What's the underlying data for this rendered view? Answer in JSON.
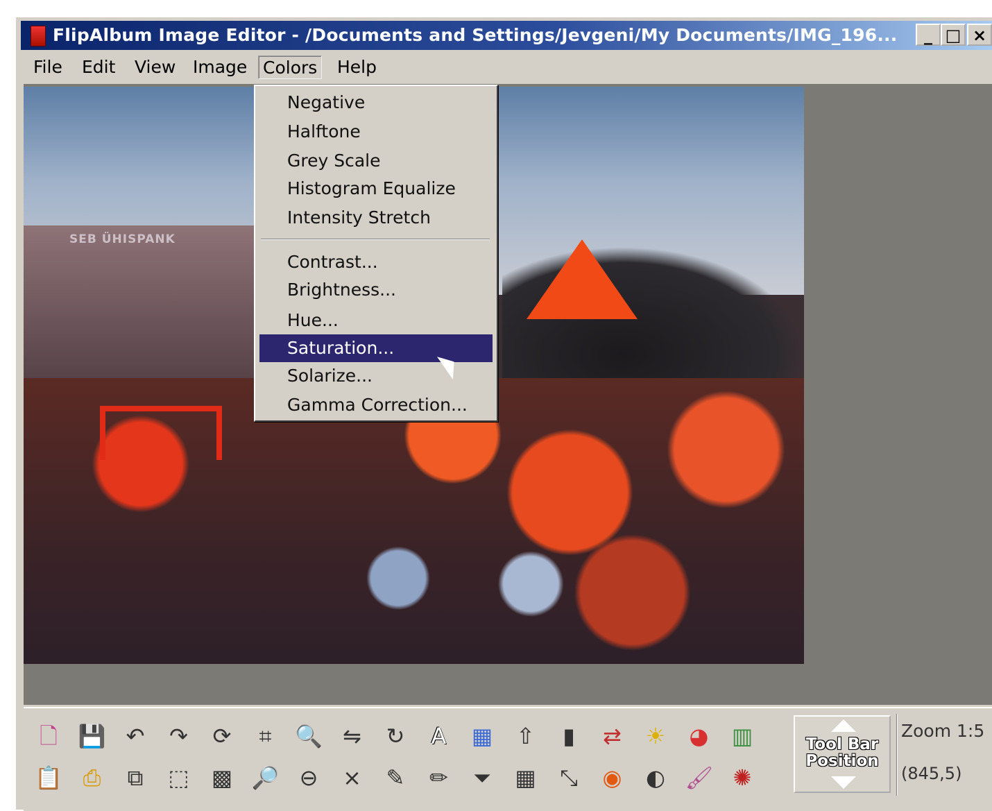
{
  "window": {
    "title": "FlipAlbum Image Editor - /Documents and Settings/Jevgeni/My Documents/IMG_196...",
    "minimize_label": "_",
    "maximize_label": "□",
    "close_label": "×"
  },
  "menubar": {
    "items": [
      {
        "label": "File"
      },
      {
        "label": "Edit"
      },
      {
        "label": "View"
      },
      {
        "label": "Image"
      },
      {
        "label": "Colors"
      },
      {
        "label": "Help"
      }
    ]
  },
  "colors_menu": {
    "group1": [
      "Negative",
      "Halftone",
      "Grey Scale",
      "Histogram Equalize",
      "Intensity Stretch"
    ],
    "group2": [
      "Contrast...",
      "Brightness...",
      "Hue...",
      "Saturation...",
      "Solarize...",
      "Gamma Correction..."
    ],
    "selected": "Saturation..."
  },
  "photo": {
    "sign_text": "SEB ÜHISPANK"
  },
  "toolbar": {
    "row1_icons": [
      "new-page-icon",
      "save-icon",
      "undo-icon",
      "redo-icon",
      "rotate-icon",
      "crop-icon",
      "zoom-in-icon",
      "flip-icon",
      "rotate-free-icon",
      "text-icon",
      "color-fill-icon",
      "upload-icon",
      "gradient-icon",
      "swap-icon",
      "brightness-icon",
      "color-wheel-icon",
      "histogram-icon"
    ],
    "row2_icons": [
      "paste-icon",
      "print-icon",
      "copy-icon",
      "select-rect-icon",
      "mosaic-icon",
      "zoom-icon",
      "zoom-out-icon",
      "mirror-icon",
      "pen-icon",
      "pencil-icon",
      "filter-icon",
      "grid-icon",
      "resize-icon",
      "target-icon",
      "contrast-icon",
      "brush-icon",
      "redeye-icon"
    ],
    "position_button_label": "Tool Bar Position",
    "zoom_text": "Zoom 1:5",
    "coord_text": "(845,5)"
  },
  "accent_colors": {
    "titlebar": "#0a246a",
    "selection": "#2c266e",
    "chrome": "#d4d0c8"
  }
}
